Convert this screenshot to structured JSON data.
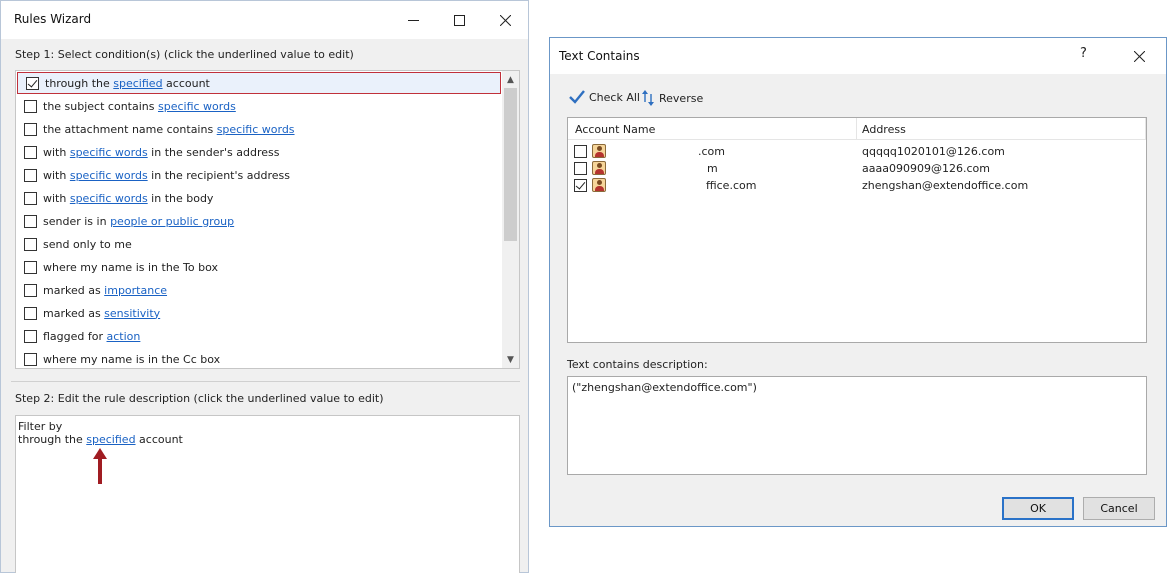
{
  "rules_wizard": {
    "title": "Rules Wizard",
    "step1_label": "Step 1: Select condition(s) (click the underlined value to edit)",
    "conditions": [
      {
        "checked": true,
        "pre": "through the ",
        "link": "specified",
        "post": " account"
      },
      {
        "checked": false,
        "pre": "the subject contains ",
        "link": "specific words",
        "post": ""
      },
      {
        "checked": false,
        "pre": "the attachment name contains ",
        "link": "specific words",
        "post": ""
      },
      {
        "checked": false,
        "pre": "with ",
        "link": "specific words",
        "post": " in the sender's address"
      },
      {
        "checked": false,
        "pre": "with ",
        "link": "specific words",
        "post": " in the recipient's address"
      },
      {
        "checked": false,
        "pre": "with ",
        "link": "specific words",
        "post": " in the body"
      },
      {
        "checked": false,
        "pre": "sender is in ",
        "link": "people or public group",
        "post": ""
      },
      {
        "checked": false,
        "pre": "send only to me",
        "link": "",
        "post": ""
      },
      {
        "checked": false,
        "pre": "where my name is in the To box",
        "link": "",
        "post": ""
      },
      {
        "checked": false,
        "pre": "marked as ",
        "link": "importance",
        "post": ""
      },
      {
        "checked": false,
        "pre": "marked as ",
        "link": "sensitivity",
        "post": ""
      },
      {
        "checked": false,
        "pre": "flagged for ",
        "link": "action",
        "post": ""
      },
      {
        "checked": false,
        "pre": "where my name is in the Cc box",
        "link": "",
        "post": ""
      }
    ],
    "step2_label": "Step 2: Edit the rule description (click the underlined value to edit)",
    "description": {
      "line1": "Filter by",
      "line2_pre": "through the ",
      "line2_link": "specified",
      "line2_post": " account"
    },
    "arrow_color": "#a01c22"
  },
  "text_contains": {
    "title": "Text Contains",
    "help": "?",
    "check_all": "Check All",
    "reverse": "Reverse",
    "columns": [
      "Account Name",
      "Address"
    ],
    "accounts": [
      {
        "checked": false,
        "name": ".com",
        "address": "qqqqq1020101@126.com"
      },
      {
        "checked": false,
        "name": "m",
        "address": "aaaa090909@126.com"
      },
      {
        "checked": true,
        "name": "ffice.com",
        "address": "zhengshan@extendoffice.com"
      }
    ],
    "desc_label": "Text contains description:",
    "desc_value": "(\"zhengshan@extendoffice.com\")",
    "ok": "OK",
    "cancel": "Cancel"
  }
}
